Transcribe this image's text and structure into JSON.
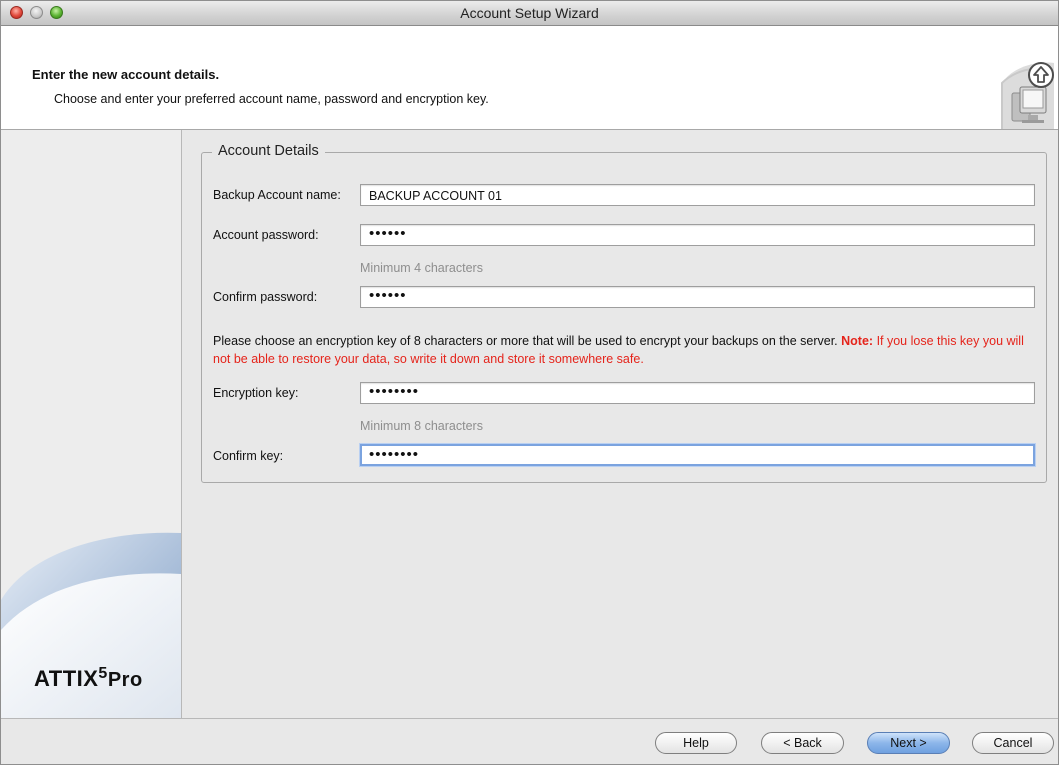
{
  "window": {
    "title": "Account Setup Wizard"
  },
  "header": {
    "heading": "Enter the new account details.",
    "subtitle": "Choose and enter your preferred account name, password and encryption key."
  },
  "brand": {
    "name": "ATTIX",
    "superscript": "5",
    "suffix": "Pro"
  },
  "form": {
    "legend": "Account Details",
    "account_name": {
      "label": "Backup Account name:",
      "value": "BACKUP ACCOUNT 01"
    },
    "account_password": {
      "label": "Account password:",
      "value": "••••••",
      "hint": "Minimum 4 characters"
    },
    "confirm_password": {
      "label": "Confirm password:",
      "value": "••••••"
    },
    "encryption_note": {
      "text": "Please choose an encryption key of 8 characters or more that will be used to encrypt your backups on the server.",
      "note_label": "Note:",
      "warning": "If you lose this key you will not be able to restore your data, so write it down and store it somewhere safe."
    },
    "encryption_key": {
      "label": "Encryption key:",
      "value": "••••••••",
      "hint": "Minimum 8 characters"
    },
    "confirm_key": {
      "label": "Confirm key:",
      "value": "••••••••"
    }
  },
  "buttons": {
    "help": "Help",
    "back": "< Back",
    "next": "Next >",
    "cancel": "Cancel"
  },
  "colors": {
    "warning": "#e5241b",
    "focus_ring": "#7ba3df",
    "primary_button": "#8cb6ea"
  },
  "icons": {
    "header_logo": "computer-upload-icon"
  }
}
